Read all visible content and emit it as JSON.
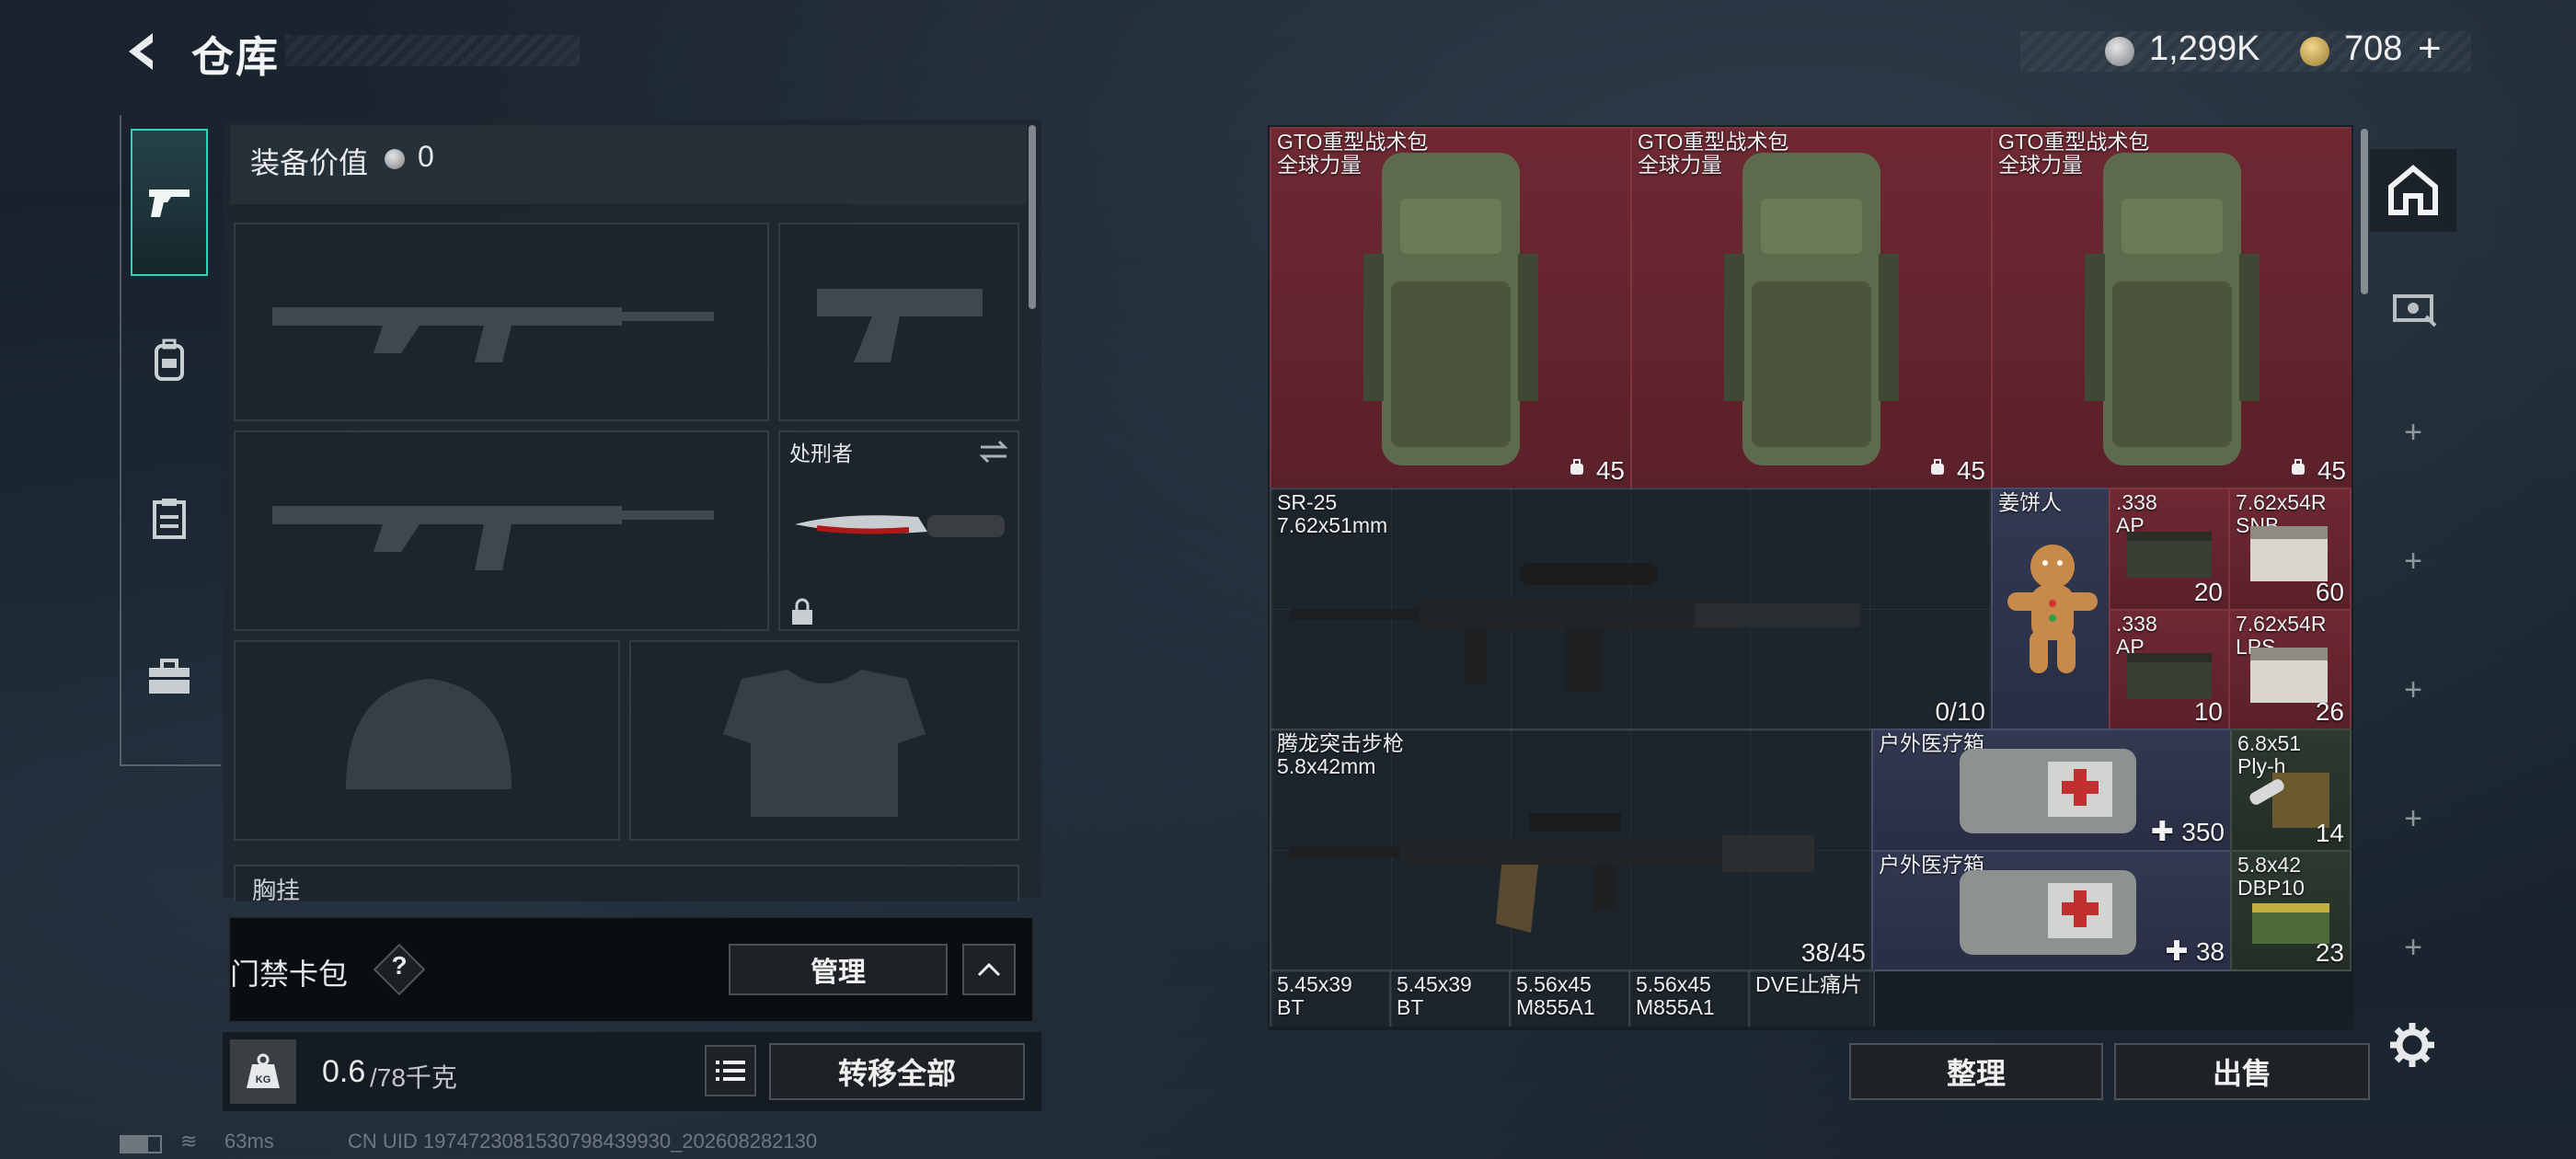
{
  "header": {
    "title": "仓库",
    "currency_silver": "1,299K",
    "currency_gold": "708"
  },
  "equipment": {
    "value_label": "装备价值",
    "value": "0",
    "melee_name": "处刑者",
    "chest_label": "胸挂",
    "access_card_label": "门禁卡包",
    "access_help": "?",
    "manage_label": "管理"
  },
  "weight": {
    "badge": "KG",
    "current": "0.6",
    "max": "/78千克",
    "transfer_all_label": "转移全部"
  },
  "storage": {
    "items": [
      {
        "name": "GTO重型战术包\n全球力量",
        "count": "45"
      },
      {
        "name": "GTO重型战术包\n全球力量",
        "count": "45"
      },
      {
        "name": "GTO重型战术包\n全球力量",
        "count": "45"
      },
      {
        "name": "SR-25\n7.62x51mm",
        "count": "0/10"
      },
      {
        "name": "姜饼人",
        "count": ""
      },
      {
        "name": ".338\nAP",
        "count": "20"
      },
      {
        "name": "7.62x54R\nSNB",
        "count": "60"
      },
      {
        "name": ".338\nAP",
        "count": "10"
      },
      {
        "name": "7.62x54R\nLPS",
        "count": "26"
      },
      {
        "name": "腾龙突击步枪\n5.8x42mm",
        "count": "38/45"
      },
      {
        "name": "户外医疗箱",
        "count": "350"
      },
      {
        "name": "6.8x51\nPly-h",
        "count": "14"
      },
      {
        "name": "户外医疗箱",
        "count": "38"
      },
      {
        "name": "5.8x42\nDBP10",
        "count": "23"
      },
      {
        "name": "5.45x39\nBT",
        "count": ""
      },
      {
        "name": "5.45x39\nBT",
        "count": ""
      },
      {
        "name": "5.56x45\nM855A1",
        "count": ""
      },
      {
        "name": "5.56x45\nM855A1",
        "count": ""
      },
      {
        "name": "DVE止痛片",
        "count": ""
      }
    ],
    "sort_label": "整理",
    "sell_label": "出售"
  },
  "status": {
    "ping": "63ms",
    "uid": "CN UID 1974723081530798439930_202608282130"
  },
  "colors": {
    "accent": "#2fd3b8",
    "item_red": "#7a2a34",
    "item_blue": "#343a54"
  },
  "icons": {
    "back": "back-arrow-icon",
    "nav": [
      "pistol-icon",
      "backpack-icon",
      "clipboard-icon",
      "toolbox-icon"
    ],
    "side": [
      "house-icon",
      "card-scanner-icon",
      "plus-icon",
      "gear-icon"
    ]
  }
}
